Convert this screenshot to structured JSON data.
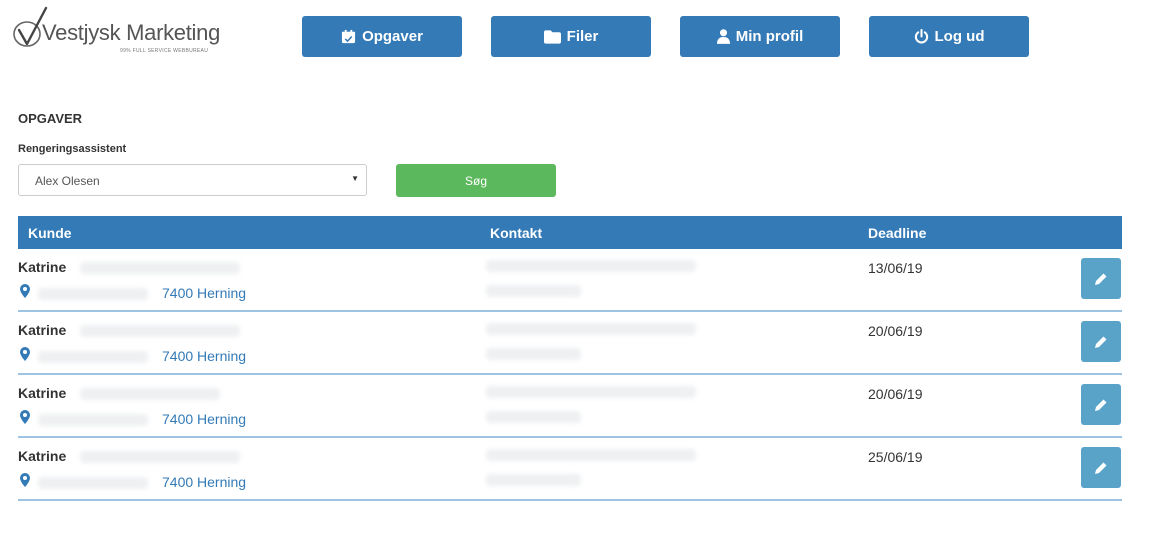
{
  "brand": {
    "name": "Vestjysk Marketing",
    "tagline": "99% FULL SERVICE WEBBUREAU"
  },
  "nav": [
    {
      "label": "Opgaver",
      "icon": "calendar-icon"
    },
    {
      "label": "Filer",
      "icon": "folder-icon"
    },
    {
      "label": "Min profil",
      "icon": "user-icon"
    },
    {
      "label": "Log ud",
      "icon": "power-icon"
    }
  ],
  "page": {
    "title": "OPGAVER",
    "filter_label": "Rengeringsassistent",
    "filter_value": "Alex Olesen",
    "search_label": "Søg"
  },
  "table": {
    "columns": [
      "Kunde",
      "Kontakt",
      "Deadline"
    ],
    "rows": [
      {
        "name": "Katrine",
        "city": "7400 Herning",
        "deadline": "13/06/19"
      },
      {
        "name": "Katrine",
        "city": "7400 Herning",
        "deadline": "20/06/19"
      },
      {
        "name": "Katrine",
        "city": "7400 Herning",
        "deadline": "20/06/19"
      },
      {
        "name": "Katrine",
        "city": "7400 Herning",
        "deadline": "25/06/19"
      }
    ]
  },
  "colors": {
    "primary": "#337ab7",
    "success": "#5cb85c",
    "edit": "#5aa3c8",
    "divider": "#9fc3e3"
  }
}
